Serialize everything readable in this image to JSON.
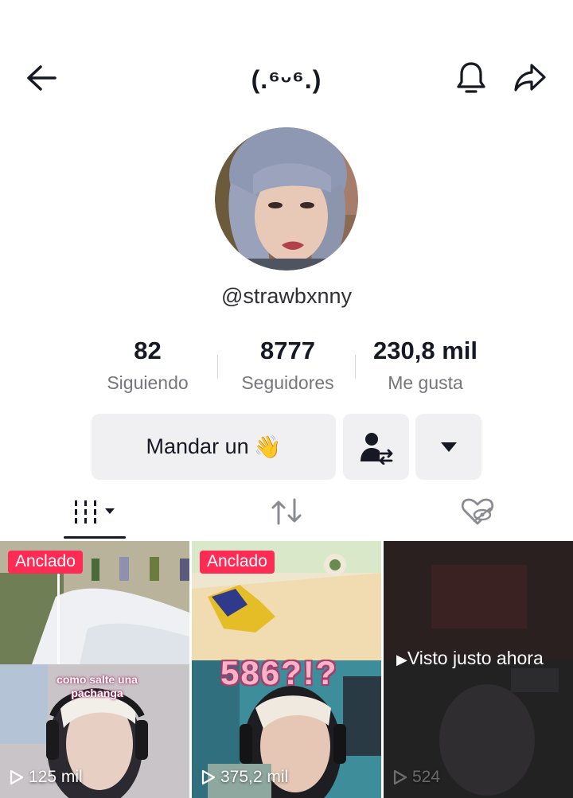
{
  "header": {
    "title": "(.⁶ᵕ⁶.)",
    "back_icon": "arrow-left-icon",
    "bell_icon": "bell-icon",
    "share_icon": "share-arrow-icon"
  },
  "profile": {
    "username": "@strawbxnny",
    "stats": [
      {
        "value": "82",
        "label": "Siguiendo"
      },
      {
        "value": "8777",
        "label": "Seguidores"
      },
      {
        "value": "230,8 mil",
        "label": "Me gusta"
      }
    ]
  },
  "actions": {
    "message_label": "Mandar un",
    "message_emoji": "👋",
    "friend_icon": "add-friend-swap-icon",
    "more_icon": "caret-down-icon"
  },
  "tabs": [
    {
      "name": "videos",
      "icon": "grid-bars-icon",
      "selected": true
    },
    {
      "name": "reposts",
      "icon": "repost-icon",
      "selected": false
    },
    {
      "name": "liked",
      "icon": "hidden-heart-icon",
      "selected": false
    }
  ],
  "videos": [
    {
      "badge": "Anclado",
      "overlay": "como salte una pachanga",
      "views": "125 mil"
    },
    {
      "badge": "Anclado",
      "overlay": "586?!?",
      "views": "375,2 mil"
    },
    {
      "status": "Visto justo ahora",
      "views": "524"
    }
  ],
  "colors": {
    "accent": "#fe2c55",
    "text": "#161823",
    "muted": "#75757d",
    "button_bg": "#f0f0f2"
  }
}
